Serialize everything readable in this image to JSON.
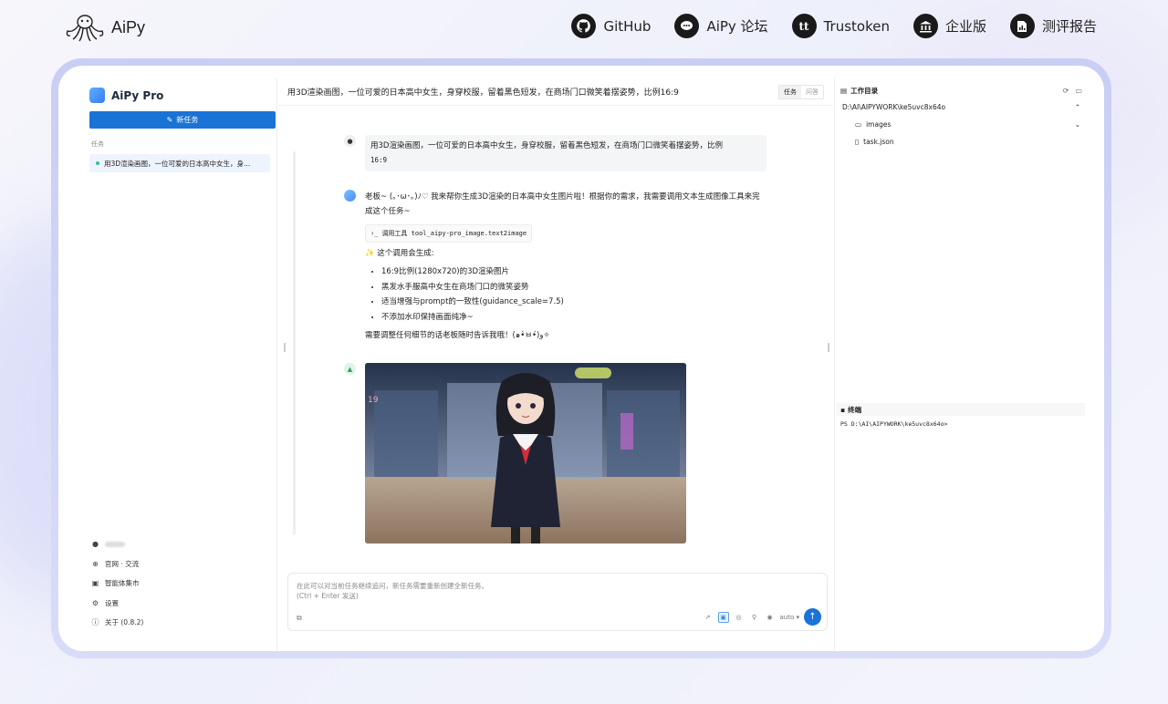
{
  "nav": {
    "logo_text": "AiPy",
    "links": [
      {
        "label": "GitHub",
        "icon": "github-icon"
      },
      {
        "label": "AiPy 论坛",
        "icon": "chat-bubble-icon"
      },
      {
        "label": "Trustoken",
        "icon": "tt-icon"
      },
      {
        "label": "企业版",
        "icon": "bank-icon"
      },
      {
        "label": "测评报告",
        "icon": "report-icon"
      }
    ]
  },
  "sidebar": {
    "brand": "AiPy Pro",
    "new_task": "新任务",
    "section_label": "任务",
    "tasks": [
      "用3D渲染画图，一位可爱的日本高中女生，身..."
    ],
    "footer": [
      {
        "label": "官网 · 交流",
        "icon": "globe-icon"
      },
      {
        "label": "智能体集市",
        "icon": "store-icon"
      },
      {
        "label": "设置",
        "icon": "gear-icon"
      },
      {
        "label": "关于  (0.8.2)",
        "icon": "info-icon"
      }
    ]
  },
  "chat": {
    "title": "用3D渲染画图，一位可爱的日本高中女生，身穿校服，留着黑色短发，在商场门口微笑着摆姿势，比例16:9",
    "modes": [
      "任务",
      "问答"
    ],
    "user_msg": "用3D渲染画图，一位可爱的日本高中女生，身穿校服，留着黑色短发，在商场门口微笑着摆姿势，比例",
    "user_msg_tail": "16:9",
    "bot_intro": "老板~ (｡･ω･｡)ﾉ♡ 我来帮你生成3D渲染的日本高中女生图片啦！根据你的需求，我需要调用文本生成图像工具来完成这个任务~",
    "tool_call": "调用工具 tool_aipy-pro_image.text2image",
    "result_intro": "✨ 这个调用会生成:",
    "bullets": [
      "16:9比例(1280x720)的3D渲染图片",
      "黑发水手服高中女生在商场门口的微笑姿势",
      "适当增强与prompt的一致性(guidance_scale=7.5)",
      "不添加水印保持画面纯净~"
    ],
    "outro": "需要调整任何细节的话老板随时告诉我哦！(๑•̀ㅂ•́)و✧",
    "composer_placeholder": "在此可以对当前任务继续追问，新任务需要重新创建全新任务。\n(Ctrl + Enter 发送)",
    "model_select": "auto ▾"
  },
  "right": {
    "workdir_title": "工作目录",
    "path": "D:\\AI\\AIPYWORK\\ke5uvc8x64o",
    "items": [
      {
        "name": "images",
        "type": "folder"
      },
      {
        "name": "task.json",
        "type": "file"
      }
    ],
    "terminal_title": "终端",
    "terminal_line": "PS D:\\AI\\AIPYWORK\\ke5uvc8x64o>"
  },
  "colors": {
    "accent": "#1a73d6",
    "frame": "#c9cef5"
  }
}
